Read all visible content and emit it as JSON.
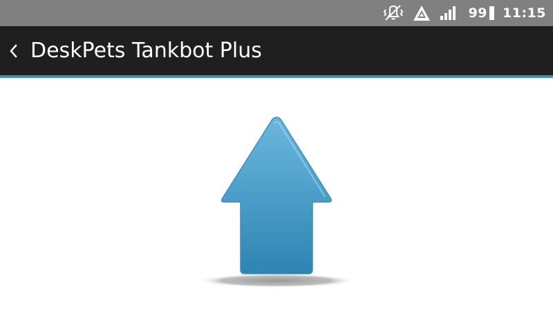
{
  "status_bar": {
    "battery_level": "99",
    "time": "11:15",
    "icons": [
      "vibrate-mute-icon",
      "data-transfer-icon",
      "signal-icon",
      "battery-icon"
    ]
  },
  "action_bar": {
    "title": "DeskPets Tankbot Plus",
    "back_icon": "chevron-left-icon"
  },
  "content": {
    "control": "up-arrow-icon"
  },
  "colors": {
    "status_bar": "#808080",
    "action_bar": "#1f1f1f",
    "accent": "#3f8fb7",
    "arrow_top": "#6ab7de",
    "arrow_bottom": "#2f84b3"
  }
}
